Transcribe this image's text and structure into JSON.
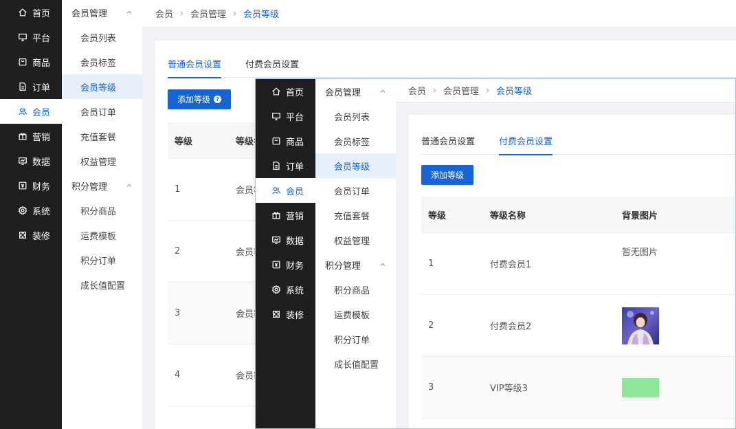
{
  "rail": [
    {
      "label": "首页",
      "icon": "home-icon"
    },
    {
      "label": "平台",
      "icon": "monitor-icon"
    },
    {
      "label": "商品",
      "icon": "bag-icon"
    },
    {
      "label": "订单",
      "icon": "document-icon"
    },
    {
      "label": "会员",
      "icon": "users-icon",
      "active": true
    },
    {
      "label": "营销",
      "icon": "gift-icon"
    },
    {
      "label": "数据",
      "icon": "chart-icon"
    },
    {
      "label": "财务",
      "icon": "finance-icon"
    },
    {
      "label": "系统",
      "icon": "gear-icon"
    },
    {
      "label": "装修",
      "icon": "puzzle-icon"
    }
  ],
  "submenu": {
    "group1": "会员管理",
    "group1_items": [
      "会员列表",
      "会员标签",
      "会员等级",
      "会员订单",
      "充值套餐",
      "权益管理"
    ],
    "group2": "积分管理",
    "group2_items": [
      "积分商品",
      "运费模板",
      "积分订单",
      "成长值配置"
    ]
  },
  "breadcrumb": [
    "会员",
    "会员管理",
    "会员等级"
  ],
  "tabs": [
    "普通会员设置",
    "付费会员设置"
  ],
  "add_button": "添加等级",
  "help_mark": "?",
  "back_table": {
    "headers": [
      "等级",
      "等级名"
    ],
    "rows": [
      {
        "level": "1",
        "name": "会员等"
      },
      {
        "level": "2",
        "name": "会员等"
      },
      {
        "level": "3",
        "name": "会员等"
      },
      {
        "level": "4",
        "name": "会员等"
      }
    ]
  },
  "front_table": {
    "headers": [
      "等级",
      "等级名称",
      "背景图片"
    ],
    "rows": [
      {
        "level": "1",
        "name": "付费会员1",
        "bg_text": "暂无图片"
      },
      {
        "level": "2",
        "name": "付费会员2",
        "bg_text": ""
      },
      {
        "level": "3",
        "name": "VIP等级3",
        "bg_text": ""
      }
    ]
  },
  "colors": {
    "accent": "#1765d4",
    "rail_bg": "#1f1f1f",
    "green_swatch": "#8ee89a"
  }
}
